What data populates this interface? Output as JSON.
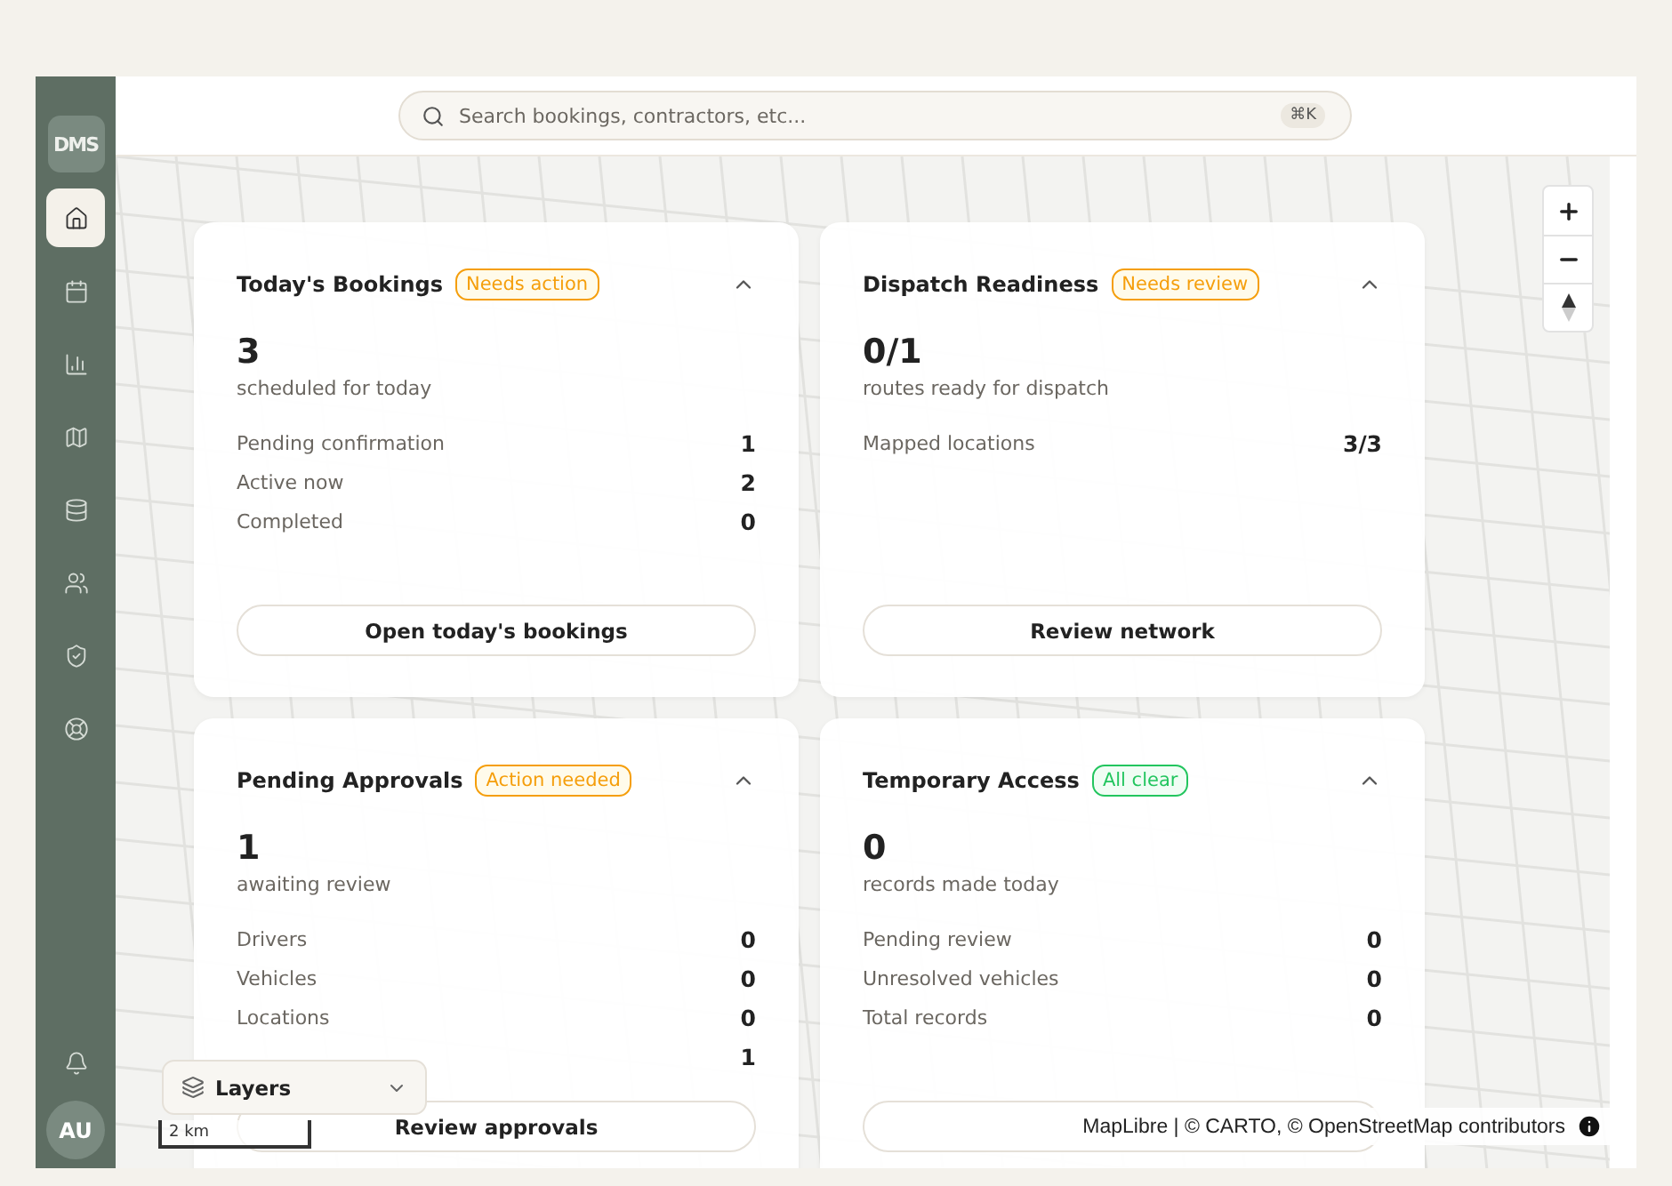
{
  "sidebar": {
    "logo": "DMS",
    "items": [
      {
        "selected": true
      },
      {
        "selected": false
      },
      {
        "selected": false
      },
      {
        "selected": false
      },
      {
        "selected": false
      },
      {
        "selected": false
      },
      {
        "selected": false
      },
      {
        "selected": false
      }
    ],
    "avatar": "AU"
  },
  "search": {
    "placeholder": "Search bookings, contractors, etc...",
    "shortcut": "⌘K"
  },
  "cards": [
    {
      "title": "Today's Bookings",
      "badge": {
        "label": "Needs action",
        "kind": "warning"
      },
      "expanded": true,
      "value": "3",
      "caption": "scheduled for today",
      "rows": [
        {
          "label": "Pending confirmation",
          "value": "1"
        },
        {
          "label": "Active now",
          "value": "2"
        },
        {
          "label": "Completed",
          "value": "0"
        }
      ],
      "button": "Open today's bookings"
    },
    {
      "title": "Dispatch Readiness",
      "badge": {
        "label": "Needs review",
        "kind": "warning"
      },
      "expanded": true,
      "value": "0/1",
      "caption": "routes ready for dispatch",
      "rows": [
        {
          "label": "Mapped locations",
          "value": "3/3"
        }
      ],
      "button": "Review network"
    },
    {
      "title": "Pending Approvals",
      "badge": {
        "label": "Action needed",
        "kind": "warning"
      },
      "expanded": true,
      "value": "1",
      "caption": "awaiting review",
      "rows": [
        {
          "label": "Drivers",
          "value": "0"
        },
        {
          "label": "Vehicles",
          "value": "0"
        },
        {
          "label": "Locations",
          "value": "0"
        },
        {
          "value": "1"
        }
      ],
      "button": "Review approvals"
    },
    {
      "title": "Temporary Access",
      "badge": {
        "label": "All clear",
        "kind": "ok"
      },
      "expanded": true,
      "value": "0",
      "caption": "records made today",
      "rows": [
        {
          "label": "Pending review",
          "value": "0"
        },
        {
          "label": "Unresolved vehicles",
          "value": "0"
        },
        {
          "label": "Total records",
          "value": "0"
        }
      ]
    }
  ],
  "map": {
    "layers": "Layers",
    "scale": "2 km",
    "attribution": "MapLibre | © CARTO, © OpenStreetMap contributors"
  }
}
